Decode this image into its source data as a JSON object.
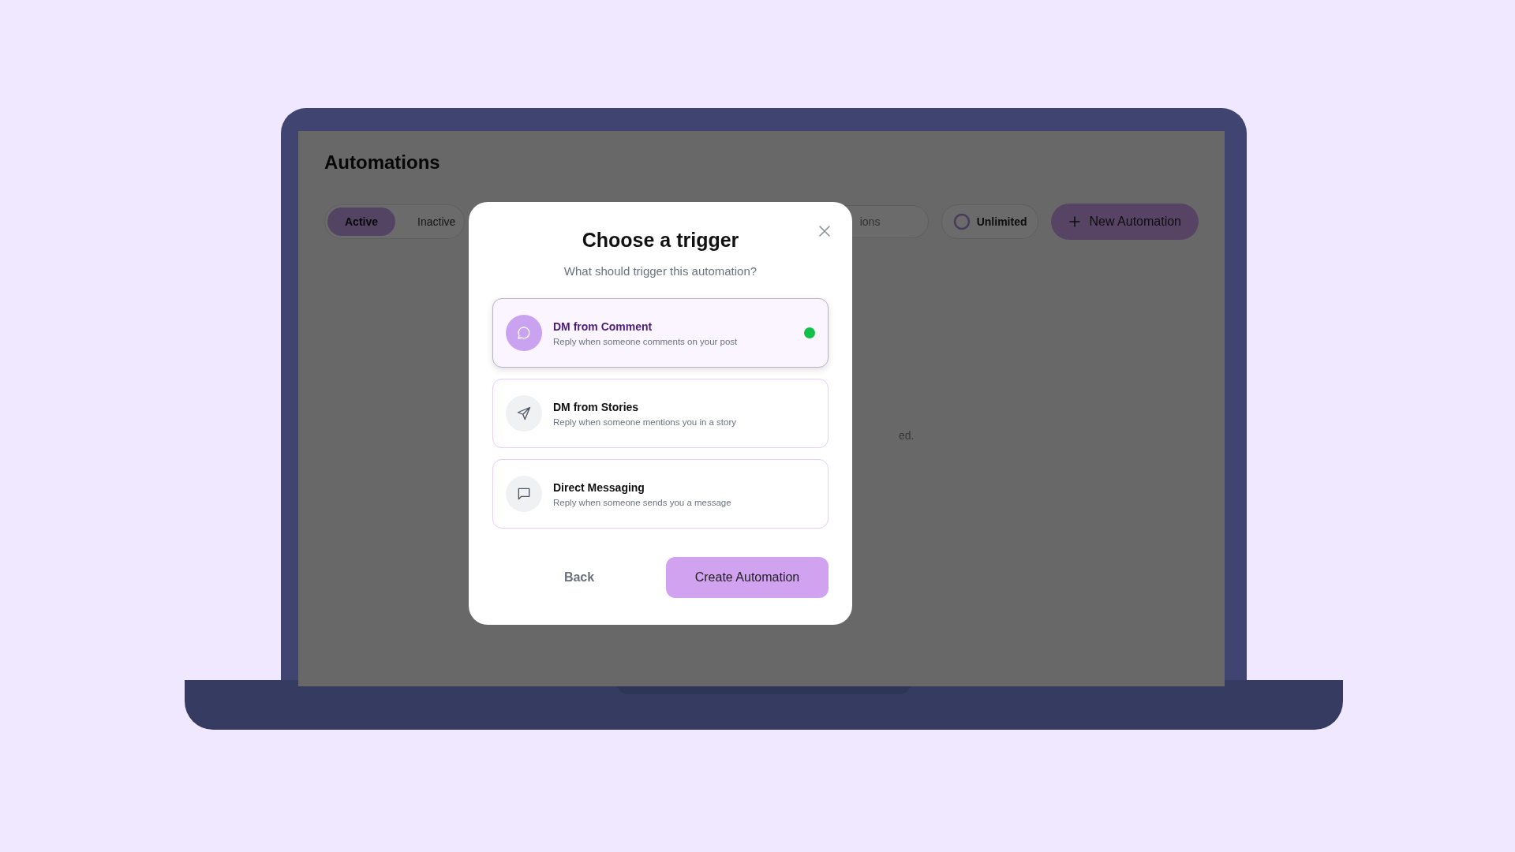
{
  "page": {
    "title": "Automations",
    "tabs": [
      {
        "label": "Active",
        "selected": true
      },
      {
        "label": "Inactive",
        "selected": false
      }
    ],
    "search": {
      "placeholder": "ions"
    },
    "plan": "Unlimited",
    "new_button": "New Automation",
    "empty_text": "ed."
  },
  "modal": {
    "title": "Choose a trigger",
    "subtitle": "What should trigger this automation?",
    "options": [
      {
        "kind": "comment",
        "title": "DM from Comment",
        "description": "Reply when someone comments on your post",
        "selected": true
      },
      {
        "kind": "story",
        "title": "DM from Stories",
        "description": "Reply when someone mentions you in a story",
        "selected": false
      },
      {
        "kind": "message",
        "title": "Direct Messaging",
        "description": "Reply when someone sends you a message",
        "selected": false
      }
    ],
    "back": "Back",
    "create": "Create Automation"
  }
}
